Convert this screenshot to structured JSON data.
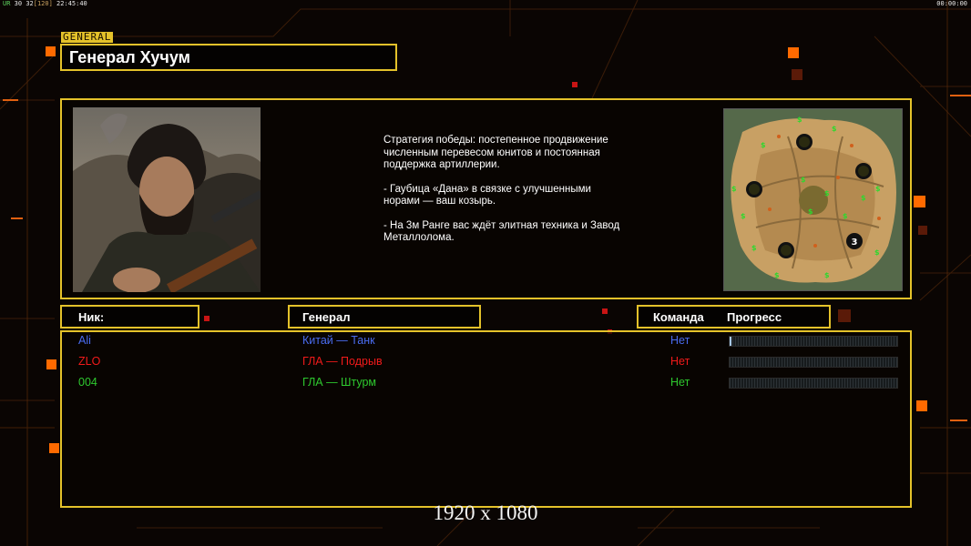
{
  "hud": {
    "left": {
      "tag": "UR",
      "count_a": "30",
      "count_b": "32",
      "bracket": "[120]",
      "clock": "22:45:40"
    },
    "right_clock": "00:00:00"
  },
  "general_tag": "GENERAL",
  "general_name": "Генерал Хучум",
  "briefing": {
    "p1": "Стратегия победы: постепенное продвижение численным перевесом юнитов и постоянная поддержка артиллерии.",
    "p2": "- Гаубица «Дана» в связке с улучшенными норами — ваш козырь.",
    "p3": "- На 3м Ранге вас ждёт элитная техника и Завод Металлолома."
  },
  "minimap": {
    "marker": "3"
  },
  "table": {
    "headers": {
      "nick": "Ник:",
      "general": "Генерал",
      "team": "Команда",
      "progress": "Прогресс"
    },
    "rows": [
      {
        "nick": "Ali",
        "general": "Китай — Танк",
        "team": "Нет",
        "progress": 0.01,
        "color": "#4a6cf0"
      },
      {
        "nick": "ZLO",
        "general": "ГЛА — Подрыв",
        "team": "Нет",
        "progress": 0,
        "color": "#f01a1a"
      },
      {
        "nick": "004",
        "general": "ГЛА — Штурм",
        "team": "Нет",
        "progress": 0,
        "color": "#2ec82e"
      }
    ]
  },
  "resolution_label": "1920 x 1080",
  "colors": {
    "accent": "#e4c22a",
    "orange": "#ff6a00"
  }
}
